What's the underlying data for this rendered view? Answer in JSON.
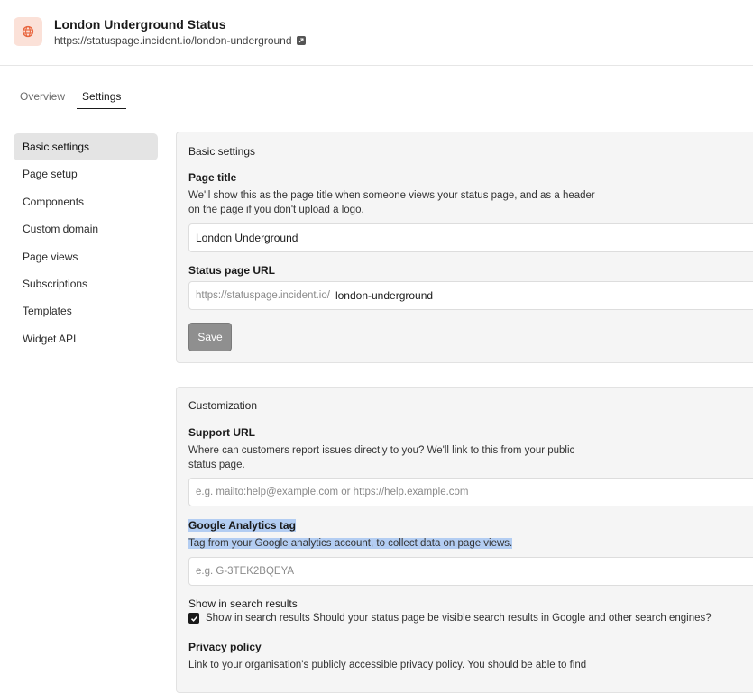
{
  "header": {
    "title": "London Underground Status",
    "url": "https://statuspage.incident.io/london-underground",
    "app_icon": "globe-icon",
    "external_icon": "external-link-icon",
    "accent": "#e8643c"
  },
  "tabs": [
    {
      "label": "Overview",
      "active": false
    },
    {
      "label": "Settings",
      "active": true
    }
  ],
  "sidebar": {
    "items": [
      {
        "label": "Basic settings",
        "active": true
      },
      {
        "label": "Page setup"
      },
      {
        "label": "Components"
      },
      {
        "label": "Custom domain"
      },
      {
        "label": "Page views"
      },
      {
        "label": "Subscriptions"
      },
      {
        "label": "Templates"
      },
      {
        "label": "Widget API"
      }
    ]
  },
  "basic": {
    "heading": "Basic settings",
    "page_title_label": "Page title",
    "page_title_help_1": "We'll show this as the page title when someone views your status page, and as a header",
    "page_title_help_2": "on the page if you don't upload a logo.",
    "page_title_value": "London Underground",
    "url_label": "Status page URL",
    "url_prefix": "https://statuspage.incident.io/",
    "url_value": "london-underground",
    "save_label": "Save"
  },
  "custom": {
    "heading": "Customization",
    "support_label": "Support URL",
    "support_help_1": "Where can customers report issues directly to you? We'll link to this from your public",
    "support_help_2": "status page.",
    "support_placeholder": "e.g. mailto:help@example.com or https://help.example.com",
    "ga_label": "Google Analytics tag",
    "ga_help": "Tag from your Google analytics account, to collect data on page views.",
    "ga_placeholder": "e.g. G-3TEK2BQEYA",
    "search_label": "Show in search results",
    "search_checkbox_label": "Show in search results Should your status page be visible search results in Google and other search engines?",
    "search_checked": true,
    "privacy_label": "Privacy policy",
    "privacy_help": "Link to your organisation's publicly accessible privacy policy. You should be able to find"
  }
}
